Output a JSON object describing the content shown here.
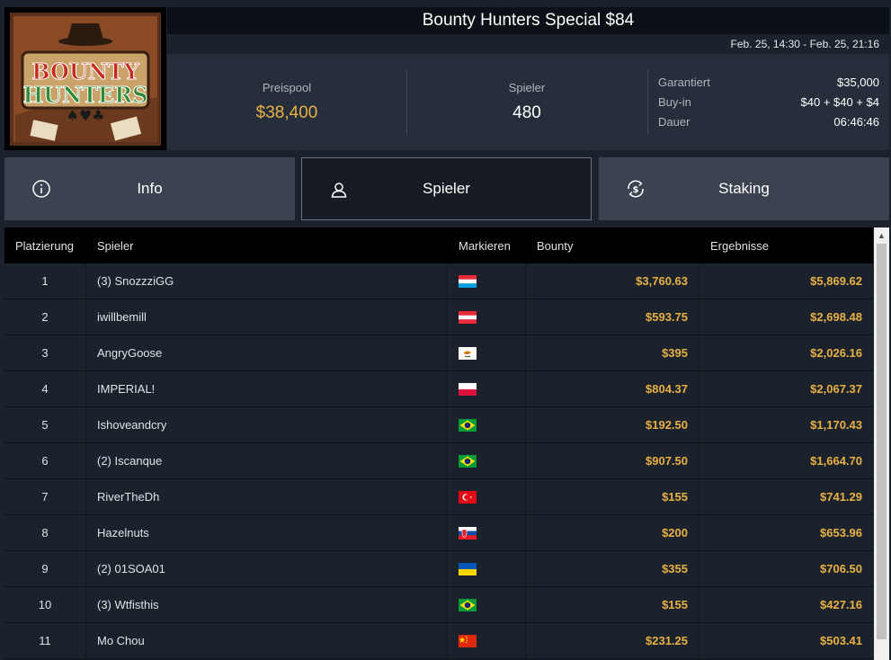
{
  "logo": {
    "line1": "BOUNTY",
    "line2": "HUNTERS"
  },
  "title": "Bounty Hunters Special $84",
  "date_range": "Feb. 25, 14:30 - Feb. 25, 21:16",
  "stats": {
    "prizepool_label": "Preispool",
    "prizepool_value": "$38,400",
    "players_label": "Spieler",
    "players_value": "480",
    "guaranteed_label": "Garantiert",
    "guaranteed_value": "$35,000",
    "buyin_label": "Buy-in",
    "buyin_value": "$40 + $40 + $4",
    "duration_label": "Dauer",
    "duration_value": "06:46:46"
  },
  "tabs": [
    {
      "label": "Info",
      "icon": "info-icon",
      "active": false
    },
    {
      "label": "Spieler",
      "icon": "user-icon",
      "active": true
    },
    {
      "label": "Staking",
      "icon": "dollar-cycle-icon",
      "active": false
    }
  ],
  "table": {
    "headers": [
      "Platzierung",
      "Spieler",
      "Markieren",
      "Bounty",
      "Ergebnisse"
    ],
    "rows": [
      {
        "place": "1",
        "player": "(3) SnozzziGG",
        "flag": "lu",
        "bounty": "$3,760.63",
        "result": "$5,869.62"
      },
      {
        "place": "2",
        "player": "iwillbemill",
        "flag": "at",
        "bounty": "$593.75",
        "result": "$2,698.48"
      },
      {
        "place": "3",
        "player": "AngryGoose",
        "flag": "cy",
        "bounty": "$395",
        "result": "$2,026.16"
      },
      {
        "place": "4",
        "player": "IMPERIAL!",
        "flag": "pl",
        "bounty": "$804.37",
        "result": "$2,067.37"
      },
      {
        "place": "5",
        "player": "Ishoveandcry",
        "flag": "br",
        "bounty": "$192.50",
        "result": "$1,170.43"
      },
      {
        "place": "6",
        "player": "(2) Iscanque",
        "flag": "br",
        "bounty": "$907.50",
        "result": "$1,664.70"
      },
      {
        "place": "7",
        "player": "RiverTheDh",
        "flag": "tr",
        "bounty": "$155",
        "result": "$741.29"
      },
      {
        "place": "8",
        "player": "Hazelnuts",
        "flag": "sk",
        "bounty": "$200",
        "result": "$653.96"
      },
      {
        "place": "9",
        "player": "(2) 01SOA01",
        "flag": "ua",
        "bounty": "$355",
        "result": "$706.50"
      },
      {
        "place": "10",
        "player": "(3) Wtfisthis",
        "flag": "br",
        "bounty": "$155",
        "result": "$427.16"
      },
      {
        "place": "11",
        "player": "Mo Chou",
        "flag": "cn",
        "bounty": "$231.25",
        "result": "$503.41"
      }
    ]
  },
  "colors": {
    "accent_gold": "#e8b146",
    "background": "#1b222c",
    "panel": "#252e3a",
    "tab": "#3b4350",
    "tab_active": "#171c24"
  }
}
